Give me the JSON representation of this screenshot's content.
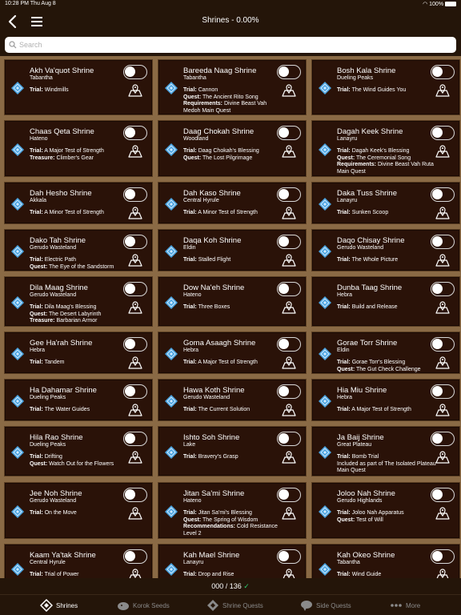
{
  "status": {
    "time_date": "10:28 PM  Thu Aug 8",
    "battery": "100%"
  },
  "nav": {
    "title": "Shrines - 0.00%"
  },
  "search": {
    "placeholder": "Search"
  },
  "shrines": [
    {
      "name": "Akh Va'quot Shrine",
      "region": "Tabantha",
      "lines": [
        [
          "Trial:",
          "Windmills"
        ]
      ]
    },
    {
      "name": "Bareeda Naag Shrine",
      "region": "Tabantha",
      "lines": [
        [
          "Trial:",
          "Cannon"
        ],
        [
          "Quest:",
          "The Ancient Rito Song"
        ],
        [
          "Requirements:",
          "Divine Beast Vah Medoh Main Quest"
        ]
      ]
    },
    {
      "name": "Bosh Kala Shrine",
      "region": "Dueling Peaks",
      "lines": [
        [
          "Trial:",
          "The Wind Guides You"
        ]
      ]
    },
    {
      "name": "Chaas Qeta Shrine",
      "region": "Hateno",
      "lines": [
        [
          "Trial:",
          "A Major Test of Strength"
        ],
        [
          "Treasure:",
          "Climber's Gear"
        ]
      ]
    },
    {
      "name": "Daag Chokah Shrine",
      "region": "Woodland",
      "lines": [
        [
          "Trial:",
          "Daag Chokah's Blessing"
        ],
        [
          "Quest:",
          "The Lost Pilgrimage"
        ]
      ]
    },
    {
      "name": "Dagah Keek Shrine",
      "region": "Lanayru",
      "lines": [
        [
          "Trial:",
          "Dagah Keek's Blessing"
        ],
        [
          "Quest:",
          "The Ceremonial Song"
        ],
        [
          "Requirements:",
          "Divine Beast Vah Ruta Main Quest"
        ]
      ]
    },
    {
      "name": "Dah Hesho Shrine",
      "region": "Akkala",
      "lines": [
        [
          "Trial:",
          "A Minor Test of Strength"
        ]
      ]
    },
    {
      "name": "Dah Kaso Shrine",
      "region": "Central Hyrule",
      "lines": [
        [
          "Trial:",
          "A Minor Test of Strength"
        ]
      ]
    },
    {
      "name": "Daka Tuss Shrine",
      "region": "Lanayru",
      "lines": [
        [
          "Trial:",
          "Sunken Scoop"
        ]
      ]
    },
    {
      "name": "Dako Tah Shrine",
      "region": "Gerudo Wasteland",
      "lines": [
        [
          "Trial:",
          "Electric Path"
        ],
        [
          "Quest:",
          "The Eye of the Sandstorm"
        ]
      ]
    },
    {
      "name": "Daqa Koh Shrine",
      "region": "Eldin",
      "lines": [
        [
          "Trial:",
          "Stalled Flight"
        ]
      ]
    },
    {
      "name": "Daqo Chisay Shrine",
      "region": "Gerudo Wasteland",
      "lines": [
        [
          "Trial:",
          "The Whole Picture"
        ]
      ]
    },
    {
      "name": "Dila Maag Shrine",
      "region": "Gerudo Wasteland",
      "lines": [
        [
          "Trial:",
          "Dila Maag's Blessing"
        ],
        [
          "Quest:",
          "The Desert Labyrinth"
        ],
        [
          "Treasure:",
          "Barbarian Armor"
        ]
      ]
    },
    {
      "name": "Dow Na'eh Shrine",
      "region": "Hateno",
      "lines": [
        [
          "Trial:",
          "Three Boxes"
        ]
      ]
    },
    {
      "name": "Dunba Taag Shrine",
      "region": "Hebra",
      "lines": [
        [
          "Trial:",
          "Build and Release"
        ]
      ]
    },
    {
      "name": "Gee Ha'rah Shrine",
      "region": "Hebra",
      "lines": [
        [
          "Trial:",
          "Tandem"
        ]
      ]
    },
    {
      "name": "Goma Asaagh Shrine",
      "region": "Hebra",
      "lines": [
        [
          "Trial:",
          "A Major Test of Strength"
        ]
      ]
    },
    {
      "name": "Gorae Torr Shrine",
      "region": "Eldin",
      "lines": [
        [
          "Trial:",
          "Gorae Torr's Blessing"
        ],
        [
          "Quest:",
          "The Gut Check Challenge"
        ]
      ]
    },
    {
      "name": "Ha Dahamar Shrine",
      "region": "Dueling Peaks",
      "lines": [
        [
          "Trial:",
          "The Water Guides"
        ]
      ]
    },
    {
      "name": "Hawa Koth Shrine",
      "region": "Gerudo Wasteland",
      "lines": [
        [
          "Trial:",
          "The Current Solution"
        ]
      ]
    },
    {
      "name": "Hia Miu Shrine",
      "region": "Hebra",
      "lines": [
        [
          "Trial:",
          "A Major Test of Strength"
        ]
      ]
    },
    {
      "name": "Hila Rao Shrine",
      "region": "Dueling Peaks",
      "lines": [
        [
          "Trial:",
          "Drifting"
        ],
        [
          "Quest:",
          "Watch Out for the Flowers"
        ]
      ]
    },
    {
      "name": "Ishto Soh Shrine",
      "region": "Lake",
      "lines": [
        [
          "Trial:",
          "Bravery's Grasp"
        ]
      ]
    },
    {
      "name": "Ja Baij Shrine",
      "region": "Great Plateau",
      "lines": [
        [
          "Trial:",
          "Bomb Trial"
        ],
        [
          "",
          "Included as part of The Isolated Plateau Main Quest"
        ]
      ]
    },
    {
      "name": "Jee Noh Shrine",
      "region": "Gerudo Wasteland",
      "lines": [
        [
          "Trial:",
          "On the Move"
        ]
      ]
    },
    {
      "name": "Jitan Sa'mi Shrine",
      "region": "Hateno",
      "lines": [
        [
          "Trial:",
          "Jitan Sa'mi's Blessing"
        ],
        [
          "Quest:",
          "The Spring of Wisdom"
        ],
        [
          "Recommendations:",
          "Cold Resistance Level 2"
        ]
      ]
    },
    {
      "name": "Joloo Nah Shrine",
      "region": "Gerudo Highlands",
      "lines": [
        [
          "Trial:",
          "Joloo Nah Apparatus"
        ],
        [
          "Quest:",
          "Test of Will"
        ]
      ]
    },
    {
      "name": "Kaam Ya'tak Shrine",
      "region": "Central Hyrule",
      "lines": [
        [
          "Trial:",
          "Trial of Power"
        ]
      ]
    },
    {
      "name": "Kah Mael Shrine",
      "region": "Lanayru",
      "lines": [
        [
          "Trial:",
          "Drop and Rise"
        ]
      ]
    },
    {
      "name": "Kah Okeo Shrine",
      "region": "Tabantha",
      "lines": [
        [
          "Trial:",
          "Wind Guide"
        ]
      ]
    }
  ],
  "progress": {
    "count": "000 / 136",
    "check": "✓"
  },
  "tabs": [
    {
      "label": "Shrines",
      "icon": "shrine-icon",
      "active": true
    },
    {
      "label": "Korok Seeds",
      "icon": "korok-icon",
      "active": false
    },
    {
      "label": "Shrine Quests",
      "icon": "shrine-quest-icon",
      "active": false
    },
    {
      "label": "Side Quests",
      "icon": "side-quest-icon",
      "active": false
    },
    {
      "label": "More",
      "icon": "more-icon",
      "active": false
    }
  ],
  "colors": {
    "card_bg": "#2a1208",
    "diamond": "#4aa3df",
    "bar_bg": "#241509",
    "accent_check": "#2ecc71"
  }
}
